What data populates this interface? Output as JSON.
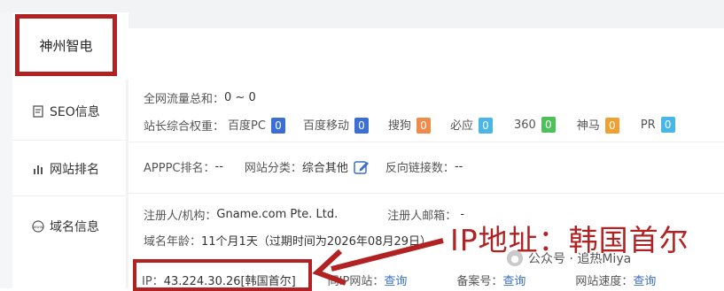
{
  "site": {
    "name": "神州智电"
  },
  "sidebar": {
    "items": [
      {
        "label": "SEO信息",
        "icon": "document-icon"
      },
      {
        "label": "网站排名",
        "icon": "bar-chart-icon"
      },
      {
        "label": "域名信息",
        "icon": "www-icon"
      }
    ]
  },
  "seo": {
    "traffic_label": "全网流量总和：",
    "traffic_value": "0 ~ 0",
    "weight_label": "站长综合权重：",
    "engines": [
      {
        "name": "百度PC",
        "value": "0",
        "color": "#3b6fd6"
      },
      {
        "name": "百度移动",
        "value": "0",
        "color": "#3b6fd6"
      },
      {
        "name": "搜狗",
        "value": "0",
        "color": "#f08a4b"
      },
      {
        "name": "必应",
        "value": "0",
        "color": "#49b6e8"
      },
      {
        "name": "360",
        "value": "0",
        "color": "#4cc15a"
      },
      {
        "name": "神马",
        "value": "0",
        "color": "#f0a030"
      },
      {
        "name": "PR",
        "value": "0",
        "color": "#49b6e8"
      }
    ]
  },
  "ranking": {
    "apppc_label": "APPPC排名：",
    "apppc_value": "--",
    "category_label": "网站分类：",
    "category_value": "综合其他",
    "backlinks_label": "反向链接数：",
    "backlinks_value": "--"
  },
  "domain": {
    "registrant_label": "注册人/机构：",
    "registrant_value": "Gname.com Pte. Ltd.",
    "email_label": "注册人邮箱：",
    "email_value": "-",
    "age_label": "域名年龄：",
    "age_value": "11个月1天",
    "expiry_text": "（过期时间为2026年08月29日）",
    "ip_label": "IP：",
    "ip_value": "43.224.30.26[韩国首尔]",
    "same_ip_label": "同IP网站：",
    "same_ip_link": "查询",
    "icp_label": "备案号：",
    "icp_link": "查询",
    "speed_label": "网站速度：",
    "speed_link": "查询"
  },
  "annotation": {
    "text": "IP地址：韩国首尔"
  },
  "watermark": {
    "text": "公众号 · 追热Miya"
  },
  "colors": {
    "annotation": "#b22222",
    "link": "#3a6fc4"
  }
}
